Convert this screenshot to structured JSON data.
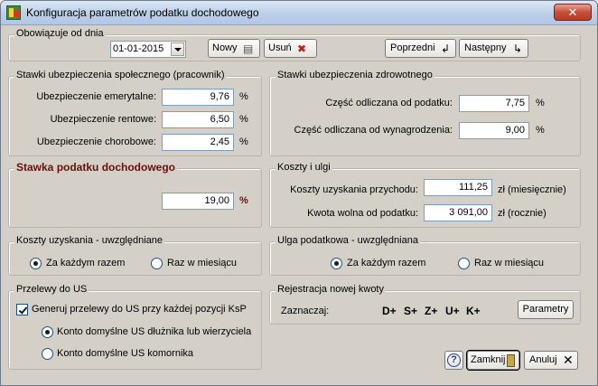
{
  "window": {
    "title": "Konfiguracja parametrów podatku dochodowego",
    "close_glyph": "✕"
  },
  "valid_from": {
    "title": "Obowiązuje od dnia",
    "date": "01-01-2015",
    "new_label": "Nowy",
    "delete_label": "Usuń",
    "prev_label": "Poprzedni",
    "next_label": "Następny"
  },
  "social": {
    "title": "Stawki ubezpieczenia społecznego (pracownik)",
    "rows": [
      {
        "label": "Ubezpieczenie emerytalne:",
        "value": "9,76",
        "unit": "%"
      },
      {
        "label": "Ubezpieczenie rentowe:",
        "value": "6,50",
        "unit": "%"
      },
      {
        "label": "Ubezpieczenie chorobowe:",
        "value": "2,45",
        "unit": "%"
      }
    ]
  },
  "health": {
    "title": "Stawki ubezpieczenia zdrowotnego",
    "rows": [
      {
        "label": "Część odliczana od podatku:",
        "value": "7,75",
        "unit": "%"
      },
      {
        "label": "Część odliczana od wynagrodzenia:",
        "value": "9,00",
        "unit": "%"
      }
    ]
  },
  "tax": {
    "title": "Stawka podatku dochodowego",
    "value": "19,00",
    "unit": "%"
  },
  "costs": {
    "title": "Koszty i ulgi",
    "rows": [
      {
        "label": "Koszty uzyskania przychodu:",
        "value": "111,25",
        "unit": "zł (miesięcznie)"
      },
      {
        "label": "Kwota wolna od podatku:",
        "value": "3 091,00",
        "unit": "zł (rocznie)"
      }
    ]
  },
  "cost_mode": {
    "title": "Koszty uzyskania - uwzględniane",
    "option1": "Za każdym razem",
    "option2": "Raz w miesiącu",
    "selected": "option1"
  },
  "relief_mode": {
    "title": "Ulga podatkowa - uwzględniana",
    "option1": "Za każdym razem",
    "option2": "Raz w miesiącu",
    "selected": "option1"
  },
  "transfers": {
    "title": "Przelewy do US",
    "generate_label": "Generuj przelewy do US przy każdej pozycji KsP",
    "generate_checked": true,
    "option1": "Konto domyślne US dłużnika lub wierzyciela",
    "option2": "Konto domyślne US komornika",
    "selected": "option1"
  },
  "registration": {
    "title": "Rejestracja nowej kwoty",
    "mark_label": "Zaznaczaj:",
    "marks": [
      "D+",
      "S+",
      "Z+",
      "U+",
      "K+"
    ],
    "params_label": "Parametry"
  },
  "footer": {
    "help_glyph": "?",
    "close_label": "Zamknij",
    "cancel_label": "Anuluj"
  },
  "colors": {
    "tax_title": "#6b0e0e",
    "dialog_bg": "#d4d0c8"
  }
}
